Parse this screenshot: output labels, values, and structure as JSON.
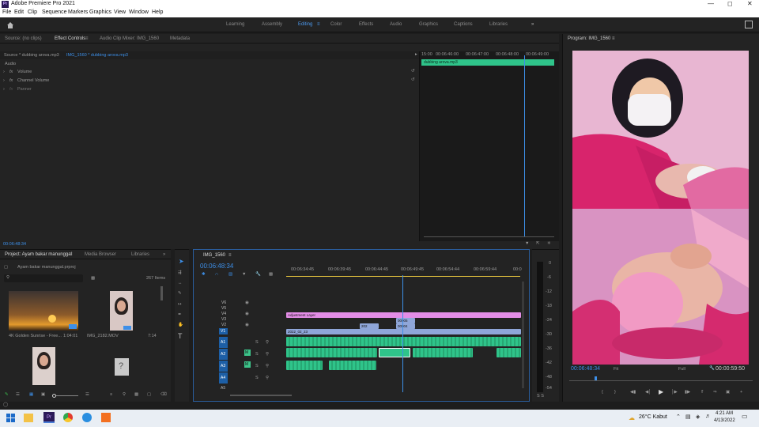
{
  "app": {
    "title": "Adobe Premiere Pro 2021",
    "logo_text": "Pr",
    "menu": [
      "File",
      "Edit",
      "Clip",
      "Sequence",
      "Markers",
      "Graphics",
      "View",
      "Window",
      "Help"
    ]
  },
  "workspaces": [
    "Learning",
    "Assembly",
    "Editing",
    "Color",
    "Effects",
    "Audio",
    "Graphics",
    "Captions",
    "Libraries"
  ],
  "workspaces_active": "Editing",
  "effect_panel": {
    "tabs": [
      "Source: (no clips)",
      "Effect Controls",
      "Audio Clip Mixer: IMG_1560",
      "Metadata"
    ],
    "source_label": "Source * dubbing arova.mp3",
    "sequence_label": "IMG_1560 * dubbing arova.mp3",
    "section": "Audio",
    "effects": [
      "Volume",
      "Channel Volume",
      "Panner"
    ],
    "fx_label": "fx",
    "ruler_labels": [
      "15:00",
      "00:06:46:00",
      "00:06:47:00",
      "00:06:48:00",
      "00:06:49:00"
    ],
    "clip_name": "dubbing arova.mp3",
    "timecode": "00:06:48:34"
  },
  "program_monitor": {
    "title": "Program: IMG_1560",
    "timecode": "00:06:48:34",
    "fit": "Fit",
    "full": "Full",
    "duration": "00:00:59:50"
  },
  "project_panel": {
    "tabs": [
      "Project: Ayam bakar manunggal",
      "Media Browser",
      "Libraries"
    ],
    "project_file": "Ayam bakar manunggal.prproj",
    "item_count": "267 Items",
    "items": [
      {
        "name": "4K Golden Sunrise - Free...",
        "duration": "1:04:01"
      },
      {
        "name": "IMG_2182.MOV",
        "duration": "7:14"
      }
    ]
  },
  "timeline": {
    "title": "IMG_1560",
    "timecode": "00:06:48:34",
    "ruler": [
      "00:06:34:45",
      "00:06:39:45",
      "00:06:44:45",
      "00:06:49:45",
      "00:06:54:44",
      "00:06:59:44",
      "00:0"
    ],
    "video_tracks": [
      "V6",
      "V5",
      "V4",
      "V3",
      "V2",
      "V1"
    ],
    "audio_tracks": [
      "A1",
      "A2",
      "A3",
      "A4",
      "A5"
    ],
    "track_buttons": {
      "mute": "M",
      "solo": "S"
    },
    "clips": {
      "adjustment": "Adjustment Layer",
      "v1_label": "2022_02_23",
      "v2_label": "202",
      "v3_label": "00005",
      "v3b_label": "00004"
    }
  },
  "meters": {
    "scale": [
      "0",
      "-6",
      "-12",
      "-18",
      "-24",
      "-30",
      "-36",
      "-42",
      "-48",
      "-54"
    ],
    "footer": "S S"
  },
  "taskbar": {
    "weather": "26°C  Kabut",
    "time": "4:21 AM",
    "date": "4/13/2022"
  },
  "colors": {
    "accent_blue": "#3d8fe8",
    "clip_green": "#2fc48a",
    "adjustment_pink": "#e38de6",
    "video_clip_blue": "#8fa6d9",
    "playhead": "#3d8fe8"
  }
}
